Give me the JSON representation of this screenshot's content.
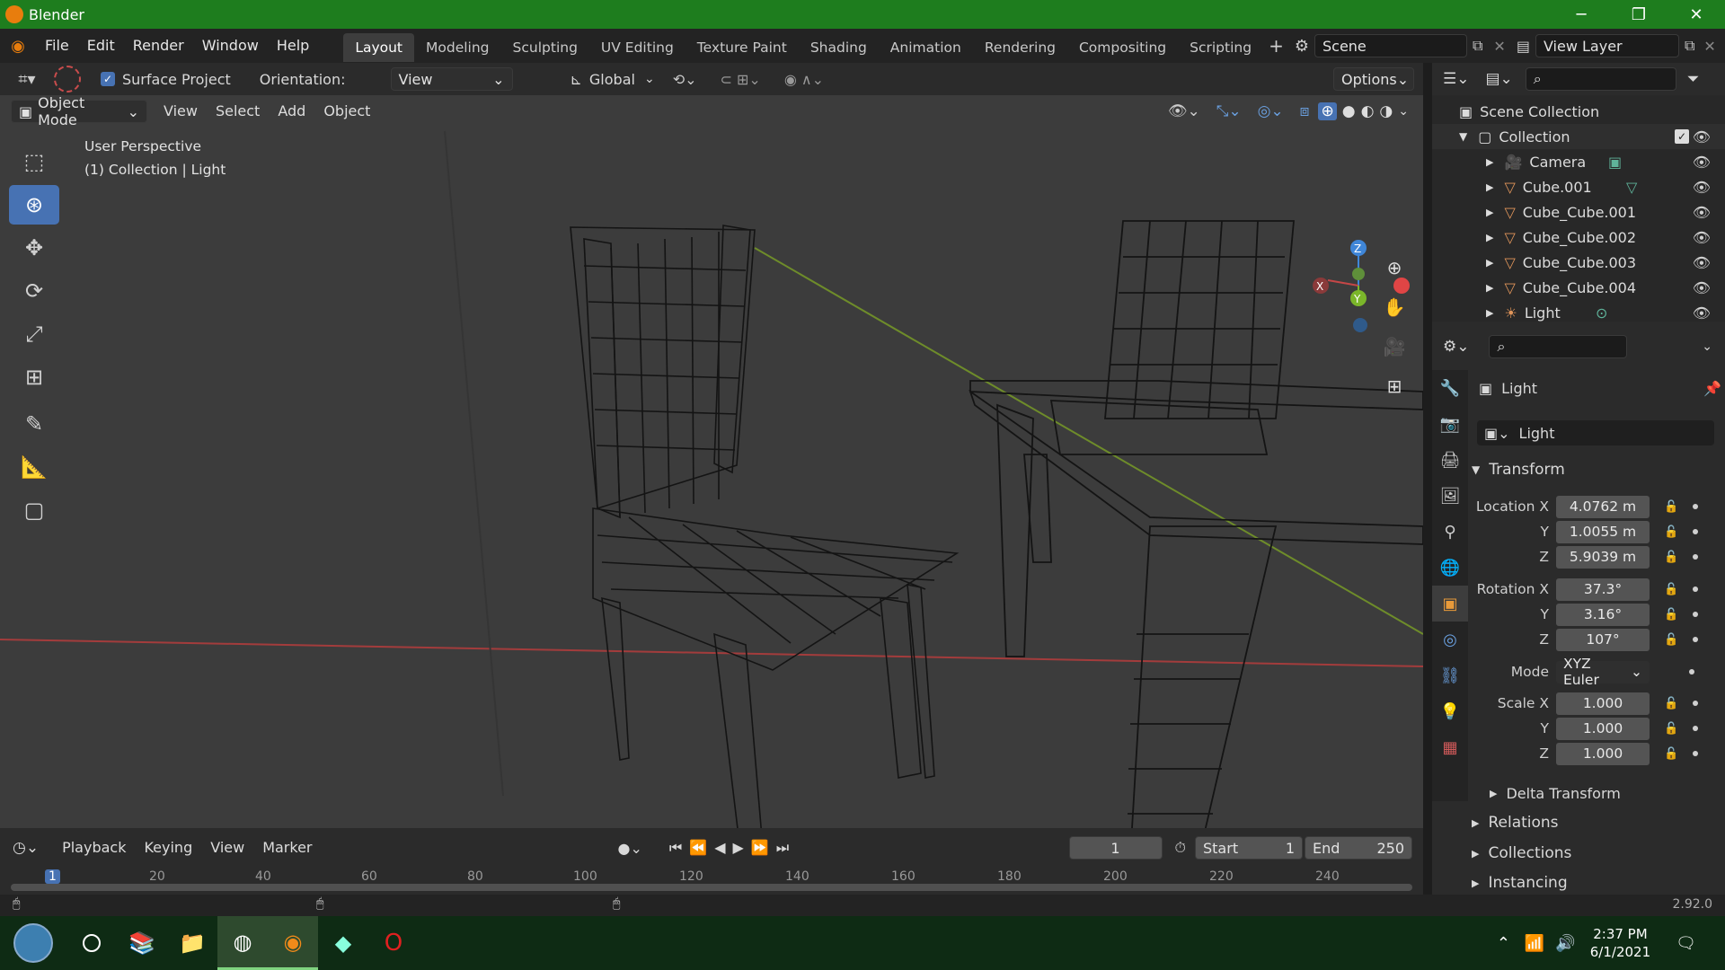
{
  "window": {
    "title": "Blender",
    "minimize": "─",
    "restore": "❐",
    "close": "✕"
  },
  "menus": [
    "File",
    "Edit",
    "Render",
    "Window",
    "Help"
  ],
  "workspaces": [
    "Layout",
    "Modeling",
    "Sculpting",
    "UV Editing",
    "Texture Paint",
    "Shading",
    "Animation",
    "Rendering",
    "Compositing",
    "Scripting"
  ],
  "active_workspace": "Layout",
  "scene": {
    "name": "Scene",
    "view_layer": "View Layer"
  },
  "tool_header": {
    "surface_project": "Surface Project",
    "orientation_label": "Orientation:",
    "orientation_value": "View",
    "transform_orientation": "Global",
    "options": "Options"
  },
  "viewport_header": {
    "mode": "Object Mode",
    "menus": [
      "View",
      "Select",
      "Add",
      "Object"
    ]
  },
  "viewport": {
    "perspective": "User Perspective",
    "context": "(1) Collection | Light",
    "axes": {
      "x": "X",
      "y": "Y",
      "z": "Z"
    }
  },
  "outliner": {
    "root": "Scene Collection",
    "collection": "Collection",
    "items": [
      {
        "name": "Camera",
        "type": "camera"
      },
      {
        "name": "Cube.001",
        "type": "mesh"
      },
      {
        "name": "Cube_Cube.001",
        "type": "mesh"
      },
      {
        "name": "Cube_Cube.002",
        "type": "mesh"
      },
      {
        "name": "Cube_Cube.003",
        "type": "mesh"
      },
      {
        "name": "Cube_Cube.004",
        "type": "mesh"
      },
      {
        "name": "Light",
        "type": "light"
      }
    ]
  },
  "properties": {
    "object_name": "Light",
    "datablock": "Light",
    "transform_title": "Transform",
    "location_label": "Location X",
    "rotation_label": "Rotation X",
    "scale_label": "Scale X",
    "y_label": "Y",
    "z_label": "Z",
    "mode_label": "Mode",
    "location": {
      "x": "4.0762 m",
      "y": "1.0055 m",
      "z": "5.9039 m"
    },
    "rotation": {
      "x": "37.3°",
      "y": "3.16°",
      "z": "107°"
    },
    "mode": "XYZ Euler",
    "scale": {
      "x": "1.000",
      "y": "1.000",
      "z": "1.000"
    },
    "sections": [
      "Delta Transform",
      "Relations",
      "Collections",
      "Instancing"
    ]
  },
  "timeline": {
    "menus": [
      "Playback",
      "Keying",
      "View",
      "Marker"
    ],
    "current_frame": "1",
    "start_label": "Start",
    "start": "1",
    "end_label": "End",
    "end": "250",
    "ticks": [
      "1",
      "20",
      "40",
      "60",
      "80",
      "100",
      "120",
      "140",
      "160",
      "180",
      "200",
      "220",
      "240"
    ]
  },
  "status": {
    "version": "2.92.0"
  },
  "taskbar": {
    "time": "2:37 PM",
    "date": "6/1/2021"
  },
  "colors": {
    "accent": "#4772b3",
    "titlebar": "#1e7d1e",
    "x_axis": "#c54747",
    "y_axis": "#7bb62a",
    "z_axis": "#3f86d8"
  }
}
